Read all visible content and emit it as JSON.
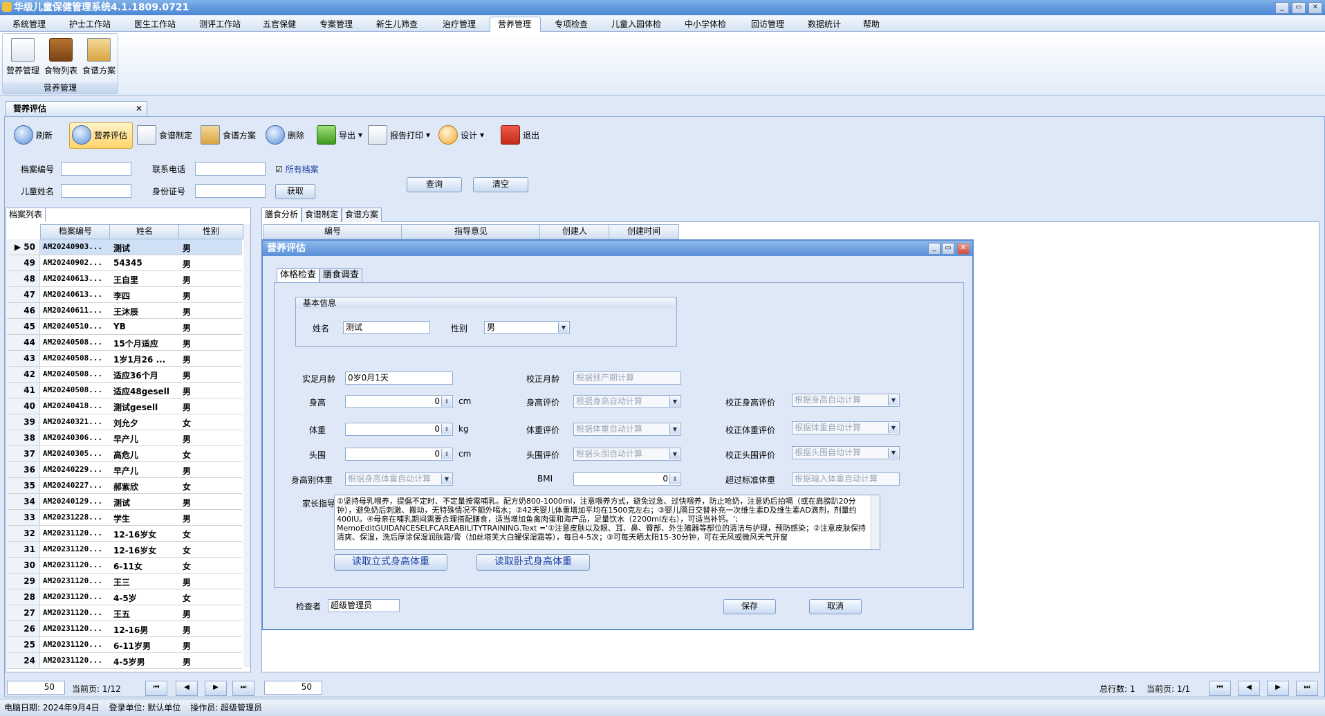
{
  "app": {
    "title": "华级儿童保健管理系统4.1.1809.0721"
  },
  "menu": [
    "系统管理",
    "护士工作站",
    "医生工作站",
    "测评工作站",
    "五官保健",
    "专案管理",
    "新生儿筛查",
    "治疗管理",
    "营养管理",
    "专项检查",
    "儿童入园体检",
    "中小学体检",
    "回访管理",
    "数据统计",
    "帮助"
  ],
  "ribbon": {
    "buttons": [
      "营养管理",
      "食物列表",
      "食谱方案"
    ],
    "group_label": "营养管理"
  },
  "doc_tab": {
    "title": "营养评估"
  },
  "toolbar": {
    "buttons": [
      "刷新",
      "营养评估",
      "食谱制定",
      "食谱方案",
      "删除",
      "导出",
      "报告打印",
      "设计",
      "退出"
    ]
  },
  "search": {
    "labels": {
      "record_no": "档案编号",
      "phone": "联系电话",
      "all": "所有档案",
      "name": "儿童姓名",
      "idcard": "身份证号"
    },
    "fetch": "获取",
    "query": "查询",
    "clear": "清空"
  },
  "left": {
    "tab": "档案列表",
    "headers": [
      "档案编号",
      "姓名",
      "性别"
    ],
    "rows": [
      [
        "50",
        "AM20240903...",
        "测试",
        "男"
      ],
      [
        "49",
        "AM20240902...",
        "54345",
        "男"
      ],
      [
        "48",
        "AM20240613...",
        "王自里",
        "男"
      ],
      [
        "47",
        "AM20240613...",
        "李四",
        "男"
      ],
      [
        "46",
        "AM20240611...",
        "王沐辰",
        "男"
      ],
      [
        "45",
        "AM20240510...",
        "YB",
        "男"
      ],
      [
        "44",
        "AM20240508...",
        "15个月适应",
        "男"
      ],
      [
        "43",
        "AM20240508...",
        "1岁1月26 ...",
        "男"
      ],
      [
        "42",
        "AM20240508...",
        "适应36个月",
        "男"
      ],
      [
        "41",
        "AM20240508...",
        "适应48gesell",
        "男"
      ],
      [
        "40",
        "AM20240418...",
        "测试gesell",
        "男"
      ],
      [
        "39",
        "AM20240321...",
        "刘允夕",
        "女"
      ],
      [
        "38",
        "AM20240306...",
        "早产儿",
        "男"
      ],
      [
        "37",
        "AM20240305...",
        "高危儿",
        "女"
      ],
      [
        "36",
        "AM20240229...",
        "早产儿",
        "男"
      ],
      [
        "35",
        "AM20240227...",
        "郝紫欣",
        "女"
      ],
      [
        "34",
        "AM20240129...",
        "测试",
        "男"
      ],
      [
        "33",
        "AM20231228...",
        "学生",
        "男"
      ],
      [
        "32",
        "AM20231120...",
        "12-16岁女",
        "女"
      ],
      [
        "31",
        "AM20231120...",
        "12-16岁女",
        "女"
      ],
      [
        "30",
        "AM20231120...",
        "6-11女",
        "女"
      ],
      [
        "29",
        "AM20231120...",
        "王三",
        "男"
      ],
      [
        "28",
        "AM20231120...",
        "4-5岁",
        "女"
      ],
      [
        "27",
        "AM20231120...",
        "王五",
        "男"
      ],
      [
        "26",
        "AM20231120...",
        "12-16男",
        "男"
      ],
      [
        "25",
        "AM20231120...",
        "6-11岁男",
        "男"
      ],
      [
        "24",
        "AM20231120...",
        "4-5岁男",
        "男"
      ]
    ],
    "pager": {
      "size": "50",
      "current": "当前页: 1/12"
    }
  },
  "right": {
    "tabs": [
      "膳食分析",
      "食谱制定",
      "食谱方案"
    ],
    "headers": [
      "编号",
      "指导意见",
      "创建人",
      "创建时间"
    ],
    "pager": {
      "size": "50",
      "total": "总行数: 1",
      "current": "当前页: 1/1"
    }
  },
  "dialog": {
    "title": "营养评估",
    "tabs": [
      "体格检查",
      "膳食调查"
    ],
    "basic_title": "基本信息",
    "fields": {
      "name_label": "姓名",
      "name": "测试",
      "sex_label": "性别",
      "sex": "男",
      "age_label": "实足月龄",
      "age": "0岁0月1天",
      "corr_age_label": "校正月龄",
      "corr_age_ph": "根据预产期计算",
      "height_label": "身高",
      "height": "0",
      "height_unit": "cm",
      "height_eval_label": "身高评价",
      "height_eval_ph": "根据身高自动计算",
      "corr_height_label": "校正身高评价",
      "corr_height_ph": "根据身高自动计算",
      "weight_label": "体重",
      "weight": "0",
      "weight_unit": "kg",
      "weight_eval_label": "体重评价",
      "weight_eval_ph": "根据体重自动计算",
      "corr_weight_label": "校正体重评价",
      "corr_weight_ph": "根据体重自动计算",
      "head_label": "头围",
      "head": "0",
      "head_unit": "cm",
      "head_eval_label": "头围评价",
      "head_eval_ph": "根据头围自动计算",
      "corr_head_label": "校正头围评价",
      "corr_head_ph": "根据头围自动计算",
      "hw_label": "身高别体重",
      "hw_ph": "根据身高体重自动计算",
      "bmi_label": "BMI",
      "bmi": "0",
      "over_label": "超过标准体重",
      "over_ph": "根据输入体重自动计算",
      "guide_label": "家长指导",
      "guide_text": "①坚持母乳喂养，提倡不定时、不定量按需哺乳。配方奶800-1000ml，注意喂养方式，避免过急、过快喂养，防止呛奶，注意奶后拍嗝（或在肩膀趴20分钟），避免奶后刺激、搬动，无特殊情况不额外喝水；②42天婴儿体重增加平均在1500克左右；③婴儿隔日交替补充一次维生素D及维生素AD滴剂，剂量约400IU。④母亲在哺乳期间需要合理搭配膳食，适当增加鱼禽肉蛋和海产品，足量饮水（2200ml左右），可适当补钙。';\nMemoEditGUIDANCESELFCAREABILITYTRAINING.Text ='①注意皮肤以及眼、耳、鼻、臀部、外生殖器等部位的清洁与护理，预防感染；②注意皮肤保持清爽、保湿，洗后厚涂保湿润肤霜/膏（加丝塔芙大白罐保湿霜等），每日4-5次；③可每天晒太阳15-30分钟，可在无风或微风天气开窗",
      "read_stand": "读取立式身高体重",
      "read_lie": "读取卧式身高体重",
      "checker_label": "检查者",
      "checker": "超级管理员",
      "save": "保存",
      "cancel": "取消"
    }
  },
  "status": {
    "date": "电脑日期: 2024年9月4日",
    "unit": "登录单位: 默认单位",
    "operator": "操作员: 超级管理员"
  }
}
